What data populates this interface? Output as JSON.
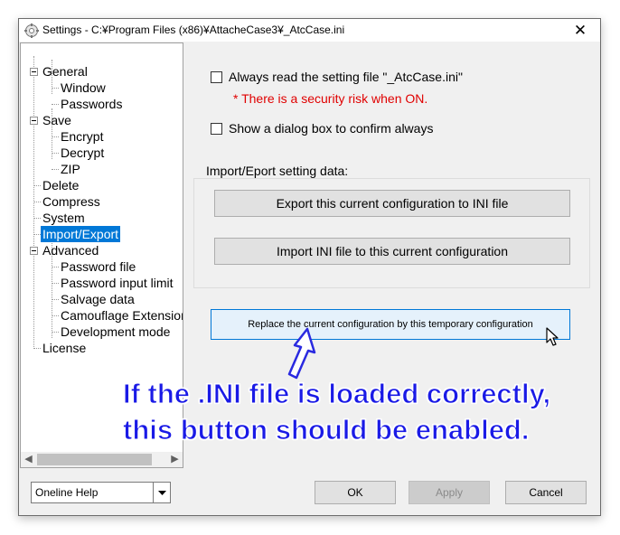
{
  "window": {
    "title": "Settings - C:¥Program Files (x86)¥AttacheCase3¥_AtcCase.ini",
    "close_glyph": "✕"
  },
  "tree": {
    "items": [
      {
        "label": "General"
      },
      {
        "label": "Window"
      },
      {
        "label": "Passwords"
      },
      {
        "label": "Save"
      },
      {
        "label": "Encrypt"
      },
      {
        "label": "Decrypt"
      },
      {
        "label": "ZIP"
      },
      {
        "label": "Delete"
      },
      {
        "label": "Compress"
      },
      {
        "label": "System"
      },
      {
        "label": "Import/Export"
      },
      {
        "label": "Advanced"
      },
      {
        "label": "Password file"
      },
      {
        "label": "Password input limit"
      },
      {
        "label": "Salvage data"
      },
      {
        "label": "Camouflage Extension"
      },
      {
        "label": "Development mode"
      },
      {
        "label": "License"
      }
    ],
    "selected": "Import/Export",
    "selection_color": "#0078d7"
  },
  "import_export": {
    "always_read_label": "Always read the setting file \"_AtcCase.ini\"",
    "always_read_checked": false,
    "security_warning": "* There is a security risk when ON.",
    "warning_color": "#e00000",
    "show_dialog_label": "Show a dialog box to confirm always",
    "show_dialog_checked": false,
    "group_label": "Import/Eport setting data:",
    "export_button": "Export this current configuration to INI file",
    "import_button": "Import INI file to this current configuration",
    "replace_button": "Replace the current configuration by this temporary configuration"
  },
  "footer": {
    "help_select_value": "Oneline Help",
    "ok_button": "OK",
    "apply_button": "Apply",
    "cancel_button": "Cancel"
  },
  "annotation": {
    "line1": "If the .INI file is loaded correctly,",
    "line2": "this button should be enabled.",
    "color": "#1a1ae6"
  },
  "icons": {
    "app": "gear-icon",
    "close": "close-icon",
    "dropdown": "chevron-down-icon",
    "scroll_left": "scroll-left-icon",
    "scroll_right": "scroll-right-icon",
    "annotation_arrow": "arrow-up-icon",
    "cursor": "mouse-cursor-icon"
  }
}
